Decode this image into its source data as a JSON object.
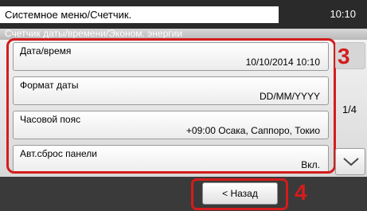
{
  "header": {
    "title": "Системное меню/Счетчик.",
    "time": "10:10",
    "subtitle": "Счетчик даты/времени/Эконом. энергии"
  },
  "settings": {
    "items": [
      {
        "label": "Дата/время",
        "value": "10/10/2014 10:10"
      },
      {
        "label": "Формат даты",
        "value": "DD/MM/YYYY"
      },
      {
        "label": "Часовой пояс",
        "value": "+09:00 Осака, Саппоро, Токио"
      },
      {
        "label": "Авт.сброс панели",
        "value": "Вкл."
      }
    ]
  },
  "pagination": {
    "indicator": "1/4"
  },
  "footer": {
    "back_label": "< Назад"
  },
  "callouts": {
    "list": "3",
    "back": "4"
  },
  "colors": {
    "highlight": "#d41c1c",
    "topbar": "#2a2a2a"
  },
  "icons": {
    "scroll_down": "chevron-down-icon",
    "scroll_up": "scroll-up-button"
  }
}
